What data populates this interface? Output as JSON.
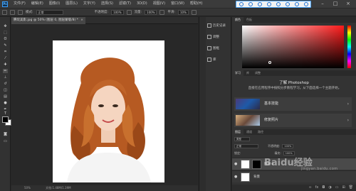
{
  "app": {
    "logo": "Ps"
  },
  "menubar": {
    "items": [
      "文件(F)",
      "编辑(E)",
      "图像(I)",
      "图层(L)",
      "文字(Y)",
      "选择(S)",
      "滤镜(T)",
      "3D(D)",
      "视图(V)",
      "窗口(W)",
      "帮助(H)"
    ]
  },
  "options_bar": {
    "mode_label": "模式:",
    "mode_value": "正常",
    "opacity_label": "不透明度:",
    "opacity_value": "100%",
    "flow_label": "流量:",
    "flow_value": "100%",
    "smooth_label": "平滑:",
    "smooth_value": "10%"
  },
  "document": {
    "tab_title": "腾玩美影.jpg @ 50% (图层 0, 图层蒙版/8) *",
    "zoom": "50%",
    "status": "文档:1.48M/1.39M"
  },
  "mid_panel": {
    "items": [
      "历史记录",
      "调整",
      "图框",
      "库"
    ]
  },
  "color_panel": {
    "tabs": [
      "颜色",
      "色板"
    ]
  },
  "learn_panel": {
    "tabs": [
      "学习",
      "库",
      "调整"
    ],
    "title": "了解 Photoshop",
    "description": "直接在应用程序中按照分步教程学习。从下面选择一个主题开始。",
    "cards": [
      {
        "label": "基本技能"
      },
      {
        "label": "修复照片"
      }
    ]
  },
  "layers_panel": {
    "tabs": [
      "图层",
      "通道",
      "路径"
    ],
    "kind_label": "类型",
    "blend_value": "正常",
    "opacity_label": "不透明度:",
    "opacity_value": "100%",
    "lock_label": "锁定:",
    "fill_label": "填充:",
    "fill_value": "100%",
    "layers": [
      {
        "name": "图层 0"
      },
      {
        "name": "背景"
      }
    ]
  },
  "watermark": {
    "text": "Baidu经验",
    "sub": "jingyan.baidu.com"
  }
}
